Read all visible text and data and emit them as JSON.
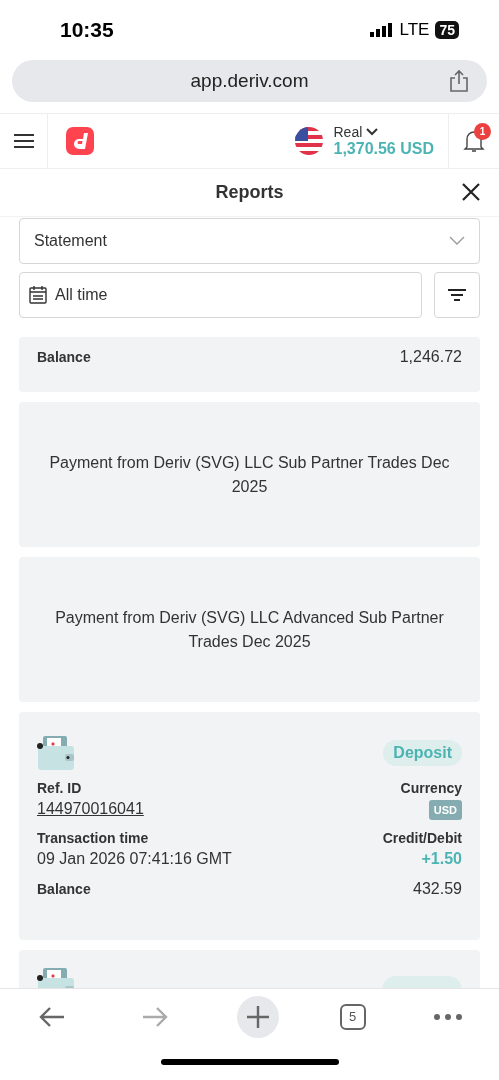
{
  "status_bar": {
    "time": "10:35",
    "network": "LTE",
    "battery": "75"
  },
  "browser": {
    "url": "app.deriv.com",
    "tab_count": "5"
  },
  "header": {
    "account_type": "Real",
    "balance": "1,370.56 USD",
    "notification_count": "1"
  },
  "reports": {
    "title": "Reports",
    "report_type": "Statement",
    "date_range": "All time"
  },
  "entries": [
    {
      "kind": "partial_top",
      "balance_label": "Balance",
      "balance": "1,246.72"
    },
    {
      "kind": "message",
      "text": "Payment from Deriv (SVG) LLC Sub Partner Trades Dec 2025"
    },
    {
      "kind": "message",
      "text": "Payment from Deriv (SVG) LLC Advanced Sub Partner Trades Dec 2025"
    },
    {
      "kind": "transaction",
      "type": "Deposit",
      "ref_label": "Ref. ID",
      "ref_id": "144970016041",
      "currency_label": "Currency",
      "currency": "USD",
      "time_label": "Transaction time",
      "time": "09 Jan 2026 07:41:16 GMT",
      "amount_label": "Credit/Debit",
      "amount": "+1.50",
      "balance_label": "Balance",
      "balance": "432.59"
    },
    {
      "kind": "partial_bottom"
    }
  ]
}
